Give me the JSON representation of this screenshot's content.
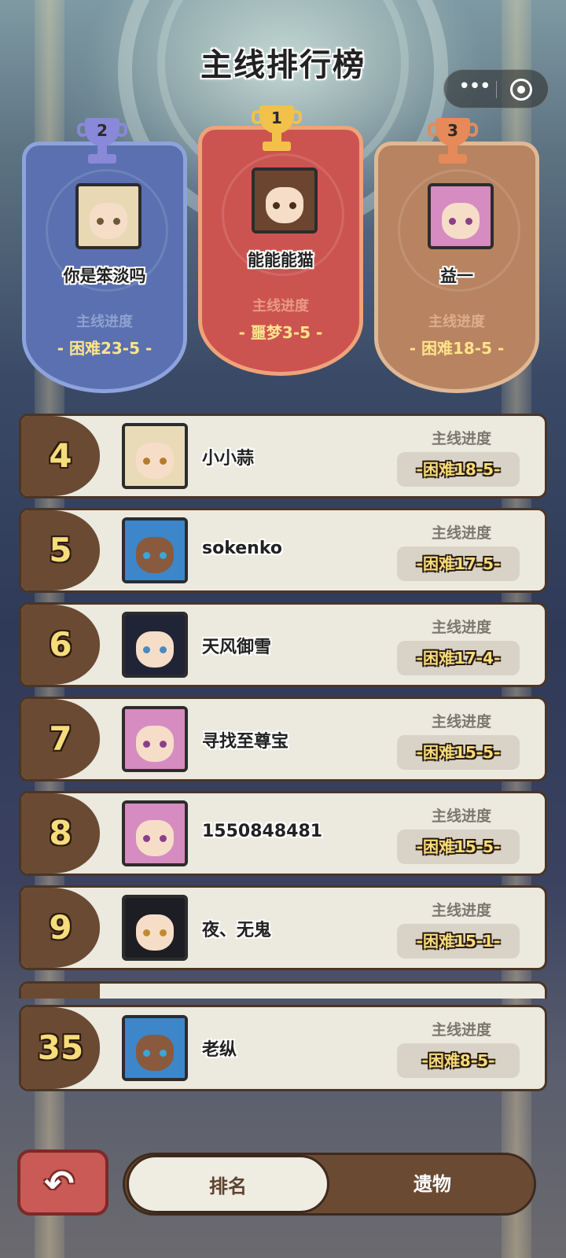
{
  "page": {
    "title": "主线排行榜",
    "capsule": {
      "more_icon": "more-dots-icon",
      "close_icon": "record-circle-icon"
    }
  },
  "podium": [
    {
      "rank": "2",
      "name": "你是笨淡吗",
      "label": "主线进度",
      "value": "- 困难23-5 -",
      "color": "#5a70b0",
      "hair": "#e9d8b4",
      "eyes": "#6b5a3a"
    },
    {
      "rank": "1",
      "name": "能能能猫",
      "label": "主线进度",
      "value": "- 噩梦3-5 -",
      "color": "#cc5450",
      "hair": "#6b4530",
      "eyes": "#4a2e1c"
    },
    {
      "rank": "3",
      "name": "益一",
      "label": "主线进度",
      "value": "- 困难18-5 -",
      "color": "#b88360",
      "hair": "#d68cc0",
      "eyes": "#8a3f8a"
    }
  ],
  "rows": [
    {
      "rank": "4",
      "name": "小小蒜",
      "label": "主线进度",
      "value": "-困难18-5-",
      "hair": "#eadbb8",
      "eyes": "#b57b2c"
    },
    {
      "rank": "5",
      "name": "sokenko",
      "label": "主线进度",
      "value": "-困难17-5-",
      "hair": "#3d86c9",
      "eyes": "#3aa7d8"
    },
    {
      "rank": "6",
      "name": "天风御雪",
      "label": "主线进度",
      "value": "-困难17-4-",
      "hair": "#1f2436",
      "eyes": "#4a8ac0"
    },
    {
      "rank": "7",
      "name": "寻找至尊宝",
      "label": "主线进度",
      "value": "-困难15-5-",
      "hair": "#d68cc0",
      "eyes": "#8a3f8a"
    },
    {
      "rank": "8",
      "name": "1550848481",
      "label": "主线进度",
      "value": "-困难15-5-",
      "hair": "#d68cc0",
      "eyes": "#8a3f8a"
    },
    {
      "rank": "9",
      "name": "夜、无鬼",
      "label": "主线进度",
      "value": "-困难15-1-",
      "hair": "#1d1d24",
      "eyes": "#c28a2e"
    },
    {
      "rank": "35",
      "name": "老纵",
      "label": "主线进度",
      "value": "-困难8-5-",
      "hair": "#3d86c9",
      "eyes": "#3aa7d8"
    }
  ],
  "footer": {
    "back_icon": "back-arrow-icon",
    "tabs": [
      {
        "label": "排名",
        "active": true
      },
      {
        "label": "遗物",
        "active": false
      }
    ]
  }
}
